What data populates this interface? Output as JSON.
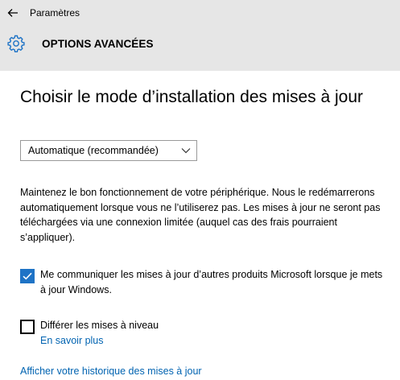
{
  "window": {
    "app_title": "Paramètres",
    "back_icon": "back-arrow-icon"
  },
  "header": {
    "icon": "gear-icon",
    "title": "OPTIONS AVANCÉES"
  },
  "install_mode": {
    "heading": "Choisir le mode d’installation des mises à jour",
    "selected_option": "Automatique (recommandée)",
    "description": "Maintenez le bon fonctionnement de votre périphérique. Nous le redémarrerons automatiquement lorsque vous ne l’utiliserez pas. Les mises à jour ne seront pas téléchargées via une connexion limitée (auquel cas des frais pourraient s’appliquer)."
  },
  "options": {
    "microsoft_updates": {
      "label": "Me communiquer les mises à jour d’autres produits Microsoft lorsque je mets à jour Windows.",
      "checked": true
    },
    "defer_upgrades": {
      "label": "Différer les mises à niveau",
      "checked": false,
      "link": "En savoir plus"
    }
  },
  "links": {
    "history": "Afficher votre historique des mises à jour"
  },
  "colors": {
    "accent": "#1e73c6",
    "link": "#0063b1",
    "header_bg": "#e6e6e6"
  }
}
